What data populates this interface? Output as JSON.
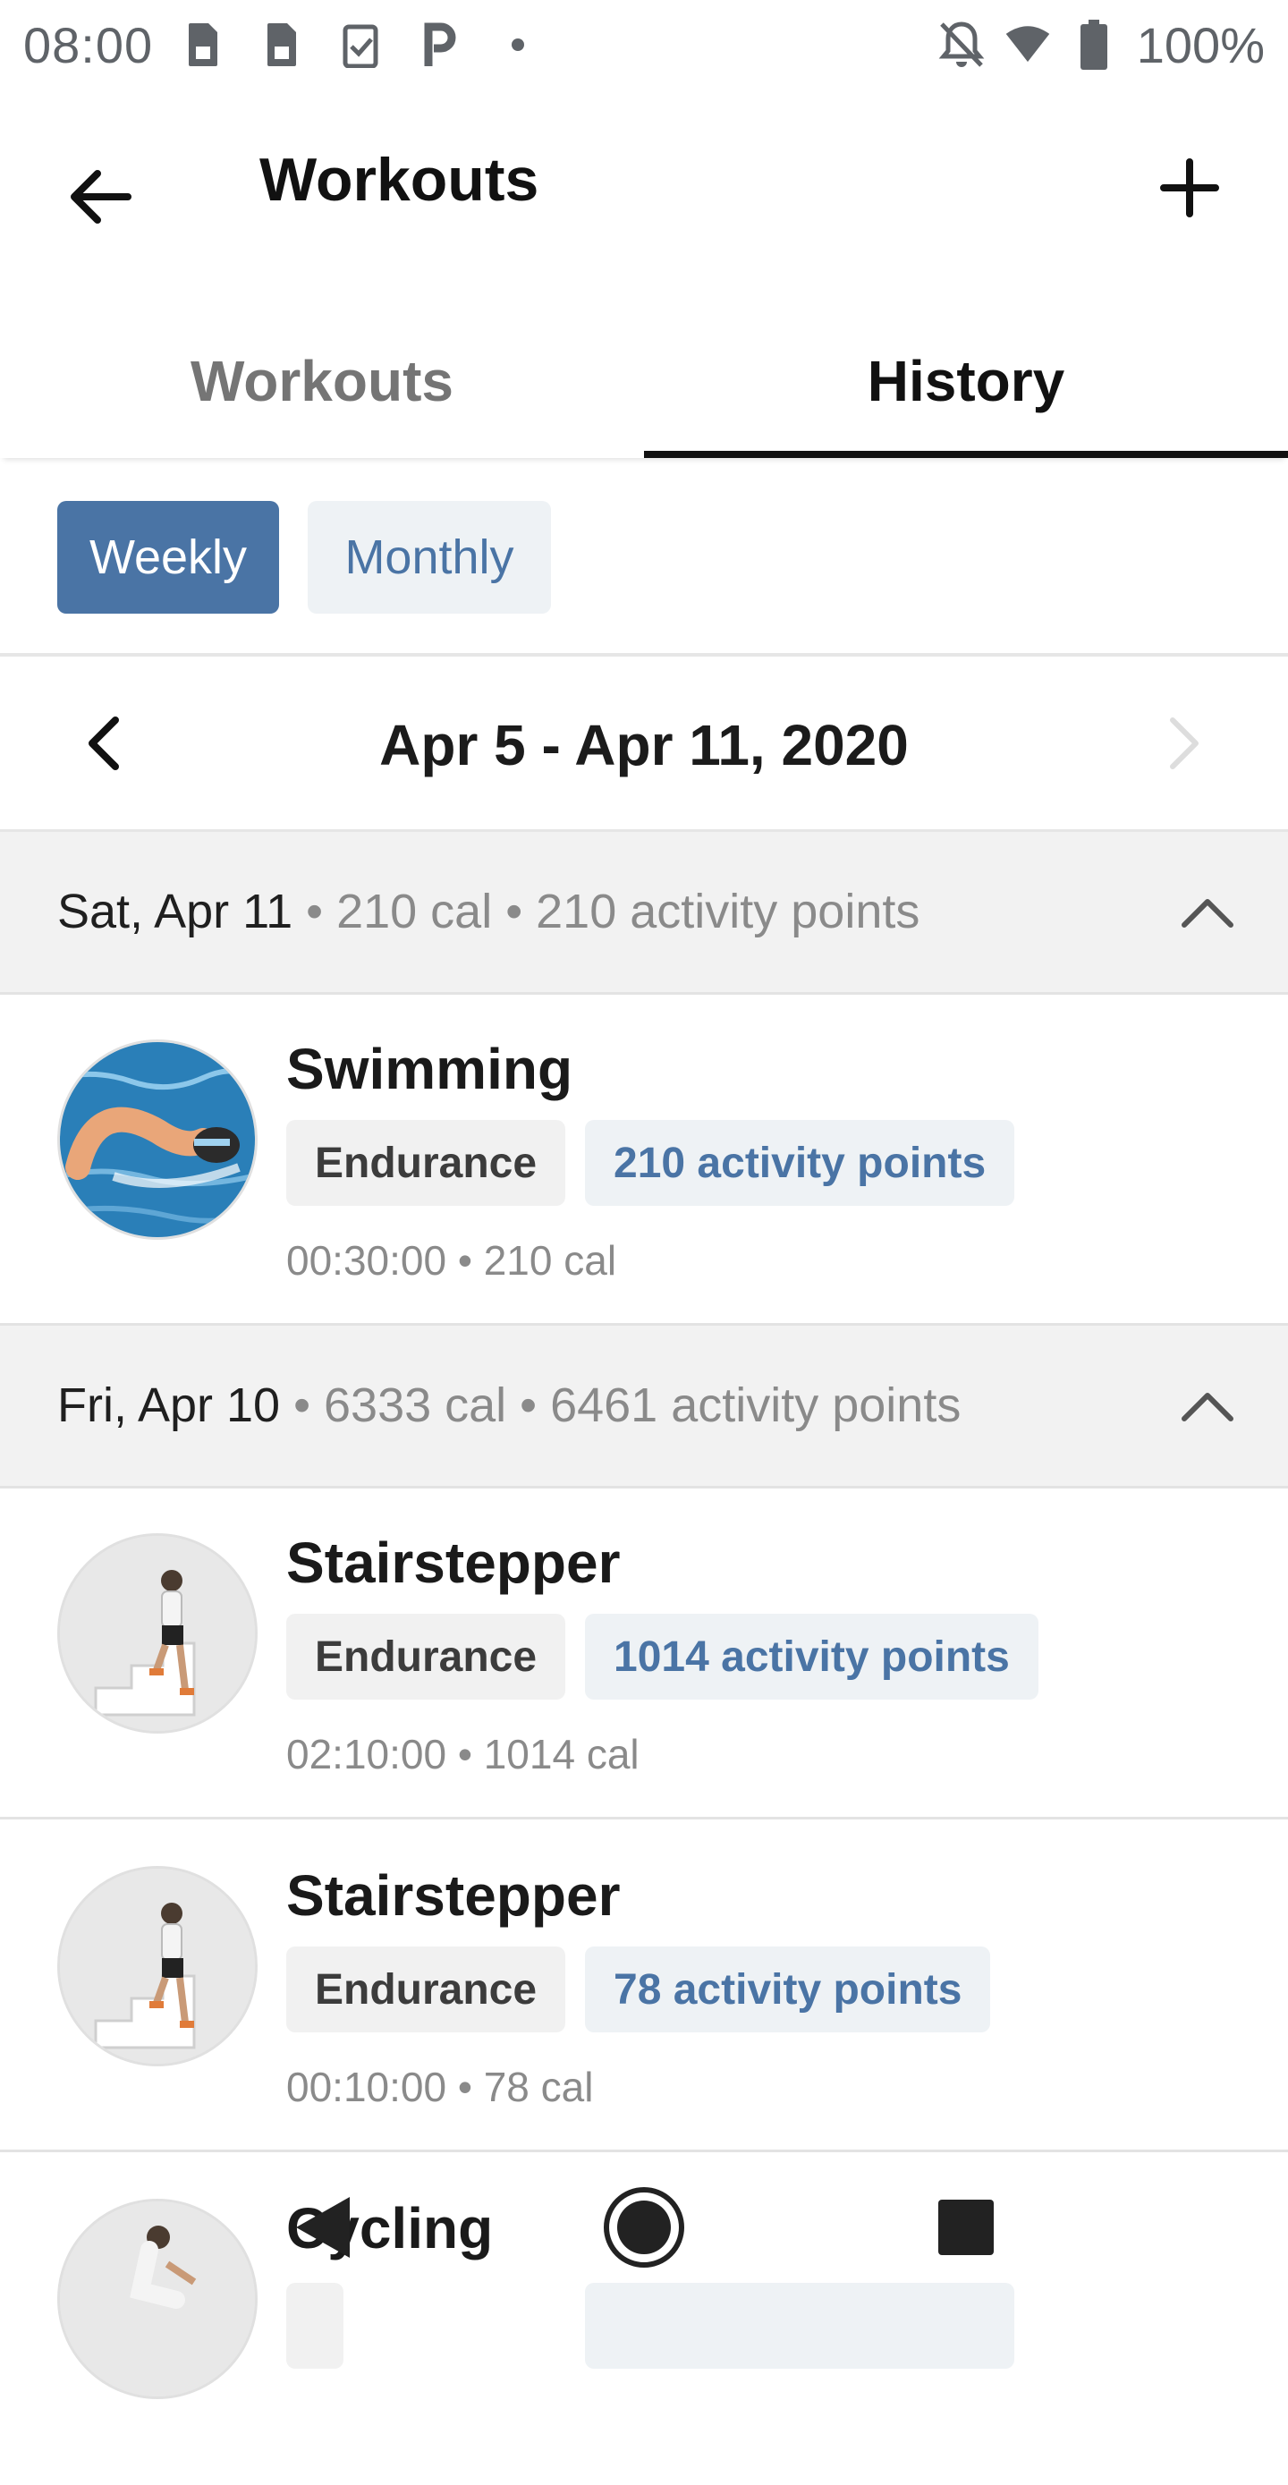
{
  "status_bar": {
    "time": "08:00",
    "battery": "100%",
    "left_icons": [
      "sim-card-icon",
      "sim-card-icon",
      "clipboard-check-icon",
      "parking-icon",
      "dot-icon"
    ],
    "right_icons": [
      "notifications-off-icon",
      "wifi-icon",
      "battery-icon"
    ]
  },
  "app_bar": {
    "title": "Workouts",
    "back_icon": "arrow-back-icon",
    "add_icon": "plus-icon"
  },
  "tabs": [
    {
      "label": "Workouts",
      "active": false
    },
    {
      "label": "History",
      "active": true
    }
  ],
  "period": {
    "weekly": "Weekly",
    "monthly": "Monthly",
    "selected": "Weekly"
  },
  "date_nav": {
    "range": "Apr 5 - Apr 11, 2020"
  },
  "days": [
    {
      "date": "Sat, Apr 11",
      "summary": " • 210 cal • 210 activity points",
      "workouts": [
        {
          "name": "Swimming",
          "type": "Endurance",
          "points": "210 activity points",
          "meta": "00:30:00 • 210 cal",
          "image": "swimmer"
        }
      ]
    },
    {
      "date": "Fri, Apr 10",
      "summary": " • 6333 cal • 6461 activity points",
      "workouts": [
        {
          "name": "Stairstepper",
          "type": "Endurance",
          "points": "1014 activity points",
          "meta": "02:10:00 • 1014 cal",
          "image": "stairstepper"
        },
        {
          "name": "Stairstepper",
          "type": "Endurance",
          "points": "78 activity points",
          "meta": "00:10:00 • 78 cal",
          "image": "stairstepper"
        },
        {
          "name": "Cycling",
          "type": "",
          "points": "",
          "meta": "",
          "image": "cyclist"
        }
      ]
    }
  ],
  "colors": {
    "accent": "#4a74a5",
    "chip_bg": "#eef2f5",
    "header_bg": "#f2f2f2"
  },
  "system_nav": [
    "back-triangle-icon",
    "home-circle-icon",
    "recents-square-icon"
  ]
}
